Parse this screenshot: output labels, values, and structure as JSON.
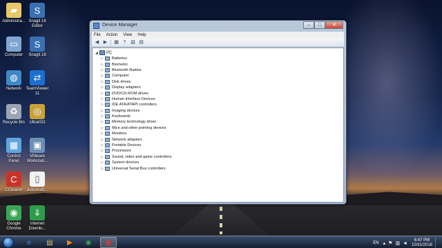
{
  "desktop": {
    "icons": [
      {
        "label": "Administra...",
        "icon": "user-folder-icon",
        "color": "#e8c66a"
      },
      {
        "label": "Snagit 18\nEditor",
        "icon": "snagit-editor-icon",
        "color": "#3a6fb0"
      },
      {
        "label": "Computer",
        "icon": "computer-icon",
        "color": "#7fa6cf"
      },
      {
        "label": "Snagit 18",
        "icon": "snagit-icon",
        "color": "#3a6fb0"
      },
      {
        "label": "Network",
        "icon": "network-icon",
        "color": "#3f88c5"
      },
      {
        "label": "TeamViewer\n11",
        "icon": "teamviewer-icon",
        "color": "#1d6fd0"
      },
      {
        "label": "Recycle Bin",
        "icon": "recycle-bin-icon",
        "color": "#9aa6b2"
      },
      {
        "label": "UltraISO",
        "icon": "ultraiso-icon",
        "color": "#c9a13b"
      },
      {
        "label": "Control\nPanel",
        "icon": "control-panel-icon",
        "color": "#5fa6dd"
      },
      {
        "label": "VMware\nWorkstati...",
        "icon": "vmware-icon",
        "color": "#6b8fb5"
      },
      {
        "label": "CCleaner",
        "icon": "ccleaner-icon",
        "color": "#c8342b"
      },
      {
        "label": "autounatt...",
        "icon": "document-icon",
        "color": "#f2f2f2"
      },
      {
        "label": "Google\nChrome",
        "icon": "chrome-icon",
        "color": "#3aa757"
      },
      {
        "label": "Internet\nDownlo...",
        "icon": "idm-icon",
        "color": "#2f9b4a"
      }
    ]
  },
  "window": {
    "title": "Device Manager",
    "menu": [
      "File",
      "Action",
      "View",
      "Help"
    ],
    "toolbar": [
      "back-icon",
      "forward-icon",
      "properties-icon",
      "help-icon",
      "scan-icon",
      "view-icon"
    ],
    "root_label": "PC",
    "devices": [
      {
        "label": "Batteries",
        "icon": "battery-icon"
      },
      {
        "label": "Biometric",
        "icon": "biometric-icon"
      },
      {
        "label": "Bluetooth Radios",
        "icon": "bluetooth-icon"
      },
      {
        "label": "Computer",
        "icon": "computer-icon"
      },
      {
        "label": "Disk drives",
        "icon": "disk-drive-icon"
      },
      {
        "label": "Display adapters",
        "icon": "display-adapter-icon"
      },
      {
        "label": "DVD/CD-ROM drives",
        "icon": "dvd-icon"
      },
      {
        "label": "Human Interface Devices",
        "icon": "hid-icon"
      },
      {
        "label": "IDE ATA/ATAPI controllers",
        "icon": "ide-icon"
      },
      {
        "label": "Imaging devices",
        "icon": "camera-icon"
      },
      {
        "label": "Keyboards",
        "icon": "keyboard-icon"
      },
      {
        "label": "Memory technology driver",
        "icon": "memory-icon"
      },
      {
        "label": "Mice and other pointing devices",
        "icon": "mouse-icon"
      },
      {
        "label": "Monitors",
        "icon": "monitor-icon"
      },
      {
        "label": "Network adapters",
        "icon": "network-adapter-icon"
      },
      {
        "label": "Portable Devices",
        "icon": "portable-device-icon"
      },
      {
        "label": "Processors",
        "icon": "processor-icon"
      },
      {
        "label": "Sound, video and game controllers",
        "icon": "sound-icon"
      },
      {
        "label": "System devices",
        "icon": "system-device-icon"
      },
      {
        "label": "Universal Serial Bus controllers",
        "icon": "usb-icon"
      }
    ]
  },
  "taskbar": {
    "apps": [
      {
        "name": "internet-explorer",
        "glyph": "e",
        "color": "#3b8ee0"
      },
      {
        "name": "explorer",
        "glyph": "▤",
        "color": "#e6c15c"
      },
      {
        "name": "media-player",
        "glyph": "▶",
        "color": "#f08a1c"
      },
      {
        "name": "chrome",
        "glyph": "◉",
        "color": "#3aa757"
      },
      {
        "name": "device-manager",
        "glyph": "▣",
        "color": "#d23b3b"
      }
    ],
    "language": "EN",
    "time": "6:47 PM",
    "date": "10/31/2018"
  }
}
